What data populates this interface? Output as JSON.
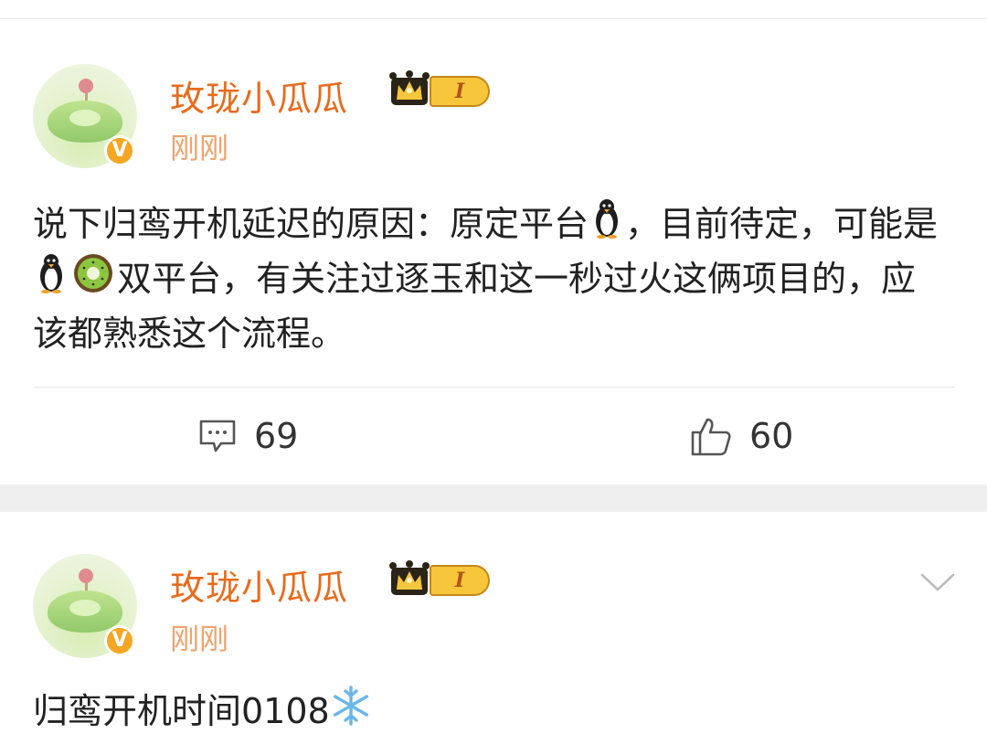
{
  "posts": [
    {
      "username": "玫珑小瓜瓜",
      "level": "I",
      "time": "刚刚",
      "verified_mark": "V",
      "content_parts": {
        "a": "说下归鸾开机延迟的原因：原定平台",
        "b": "，目前待定，可能是",
        "c": "双平台，有关注过逐玉和这一秒过火这俩项目的，应该都熟悉这个流程。"
      },
      "icons": {
        "platform1": "penguin-emoji",
        "platform2a": "penguin-emoji",
        "platform2b": "kiwi-emoji"
      },
      "comments": "69",
      "likes": "60"
    },
    {
      "username": "玫珑小瓜瓜",
      "level": "I",
      "time": "刚刚",
      "verified_mark": "V",
      "content": "归鸾开机时间0108",
      "icons": {
        "trail": "snowflake-emoji",
        "menu": "chevron-down-icon"
      }
    }
  ],
  "colors": {
    "username": "#e86b1c",
    "time": "#f2a26a",
    "badge": "#f5a623",
    "level": "#f7c63a"
  }
}
